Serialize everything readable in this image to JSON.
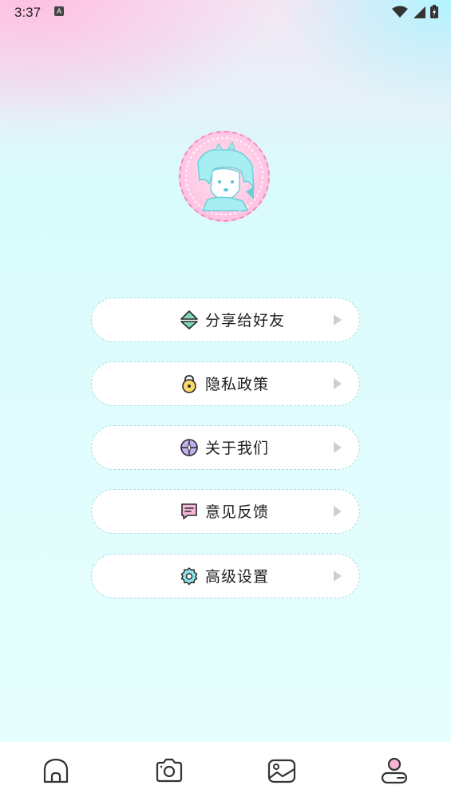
{
  "status_bar": {
    "time": "3:37",
    "notification_icon": "A",
    "icons": [
      "wifi-icon",
      "signal-icon",
      "battery-icon"
    ]
  },
  "profile": {
    "avatar": "anime-avatar"
  },
  "menu": {
    "items": [
      {
        "label": "分享给好友",
        "icon": "share-icon"
      },
      {
        "label": "隐私政策",
        "icon": "privacy-lock-icon"
      },
      {
        "label": "关于我们",
        "icon": "about-us-icon"
      },
      {
        "label": "意见反馈",
        "icon": "feedback-icon"
      },
      {
        "label": "高级设置",
        "icon": "settings-gear-icon"
      }
    ]
  },
  "bottom_nav": {
    "items": [
      {
        "icon": "home-icon",
        "active": false
      },
      {
        "icon": "camera-icon",
        "active": false
      },
      {
        "icon": "gallery-icon",
        "active": false
      },
      {
        "icon": "profile-icon",
        "active": true
      }
    ]
  },
  "colors": {
    "accent_pink": "#f28bc4",
    "accent_cyan": "#9adfe6",
    "background": "#e2fdfd"
  }
}
